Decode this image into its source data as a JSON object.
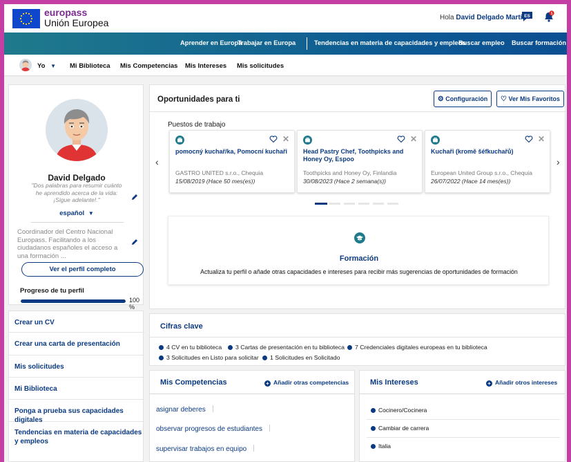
{
  "header": {
    "brand_name": "europass",
    "brand_sub": "Unión Europea",
    "greeting": "Hola",
    "user_name": "David Delgado Martín",
    "lang_code": "ES",
    "bell_count": "1"
  },
  "nav": {
    "items": [
      "Aprender en Europa",
      "Trabajar en Europa",
      "Tendencias en materia de capacidades y empleos",
      "Buscar empleo",
      "Buscar formación"
    ]
  },
  "subnav": {
    "me": "Yo",
    "items": [
      "Mi Biblioteca",
      "Mis Competencias",
      "Mis Intereses",
      "Mis solicitudes"
    ]
  },
  "profile": {
    "name": "David Delgado",
    "quote": "\"Dos palabras para resumir cuánto he aprendido acerca de la vida: ¡Sigue adelante!.\"",
    "language": "español",
    "description": "Coordinador del Centro Nacional Europass. Facilitando a los ciudadanos españoles el acceso a una formación ...",
    "view_button": "Ver el perfil completo",
    "progress_label": "Progreso de tu perfil",
    "progress_text": "100 %",
    "progress_value": 100
  },
  "left_menu": {
    "items": [
      "Crear un CV",
      "Crear una carta de presentación",
      "Mis solicitudes",
      "Mi Biblioteca",
      "Ponga a prueba sus capacidades digitales",
      "Tendencias en materia de capacidades y empleos"
    ]
  },
  "opportunities": {
    "title": "Oportunidades para ti",
    "config_button": "Configuración",
    "favorites_button": "Ver Mis Favoritos",
    "jobs_label": "Puestos de trabajo",
    "jobs": [
      {
        "title": "pomocný kuchař/ka, Pomocní kuchaři",
        "org": "GASTRO UNITED s.r.o., Chequia",
        "date": "15/08/2019 (Hace 50 mes(es))"
      },
      {
        "title": "Head Pastry Chef, Toothpicks and Honey Oy, Espoo",
        "org": "Toothpicks and Honey Oy, Finlandia",
        "date": "30/08/2023 (Hace 2 semana(s))"
      },
      {
        "title": "Kuchaři (kromě šéfkuchařů)",
        "org": "European United Group s.r.o., Chequia",
        "date": "26/07/2022 (Hace 14 mes(es))"
      }
    ],
    "training_title": "Formación",
    "training_desc": "Actualiza tu perfil o añade otras capacidades e intereses para recibir más sugerencias de oportunidades de formación"
  },
  "key_figures": {
    "title": "Cifras clave",
    "stats": [
      "4 CV en tu biblioteca",
      "3 Cartas de presentación en tu biblioteca",
      "7 Credenciales digitales europeas en tu biblioteca",
      "3 Solicitudes en Listo para solicitar",
      "1 Solicitudes en Solicitado"
    ]
  },
  "competencies": {
    "title": "Mis Competencias",
    "add": "Añadir otras competencias",
    "items": [
      "asignar deberes",
      "observar progresos de estudiantes",
      "supervisar trabajos en equipo"
    ]
  },
  "interests": {
    "title": "Mis Intereses",
    "add": "Añadir otros intereses",
    "items": [
      "Cocinero/Cocinera",
      "Cambiar de carrera",
      "Italia"
    ]
  },
  "colors": {
    "brand": "#7a2a8e",
    "primary": "#0b3a82",
    "teal": "#1f7a8c",
    "frame": "#c43fa4"
  }
}
